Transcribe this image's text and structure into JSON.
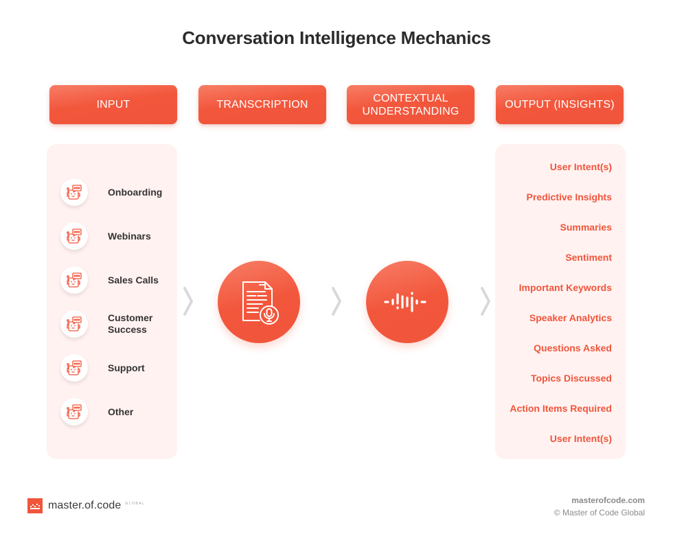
{
  "title": "Conversation Intelligence Mechanics",
  "stages": [
    {
      "label": "INPUT"
    },
    {
      "label": "TRANSCRIPTION"
    },
    {
      "label": "CONTEXTUAL\nUNDERSTANDING"
    },
    {
      "label": "OUTPUT (INSIGHTS)"
    }
  ],
  "inputs": [
    {
      "label": "Onboarding",
      "icon": "chatbot-icon"
    },
    {
      "label": "Webinars",
      "icon": "chatbot-icon"
    },
    {
      "label": "Sales Calls",
      "icon": "chatbot-icon"
    },
    {
      "label": "Customer\nSuccess",
      "icon": "chatbot-icon"
    },
    {
      "label": "Support",
      "icon": "chatbot-icon"
    },
    {
      "label": "Other",
      "icon": "chatbot-icon"
    }
  ],
  "process_icons": {
    "transcription": "document-microphone-icon",
    "understanding": "sound-wave-icon"
  },
  "outputs": [
    "User Intent(s)",
    "Predictive Insights",
    "Summaries",
    "Sentiment",
    "Important Keywords",
    "Speaker Analytics",
    "Questions Asked",
    "Topics Discussed",
    "Action Items Required",
    "User Intent(s)"
  ],
  "footer": {
    "logo_text": "master.of.code",
    "logo_sub": "GLOBAL",
    "site": "masterofcode.com",
    "copyright": "© Master of Code Global"
  },
  "colors": {
    "accent": "#f0553b",
    "panel_bg": "#fff2f1",
    "text_dark": "#2b2b2b",
    "chevron": "#d9d9d9"
  }
}
